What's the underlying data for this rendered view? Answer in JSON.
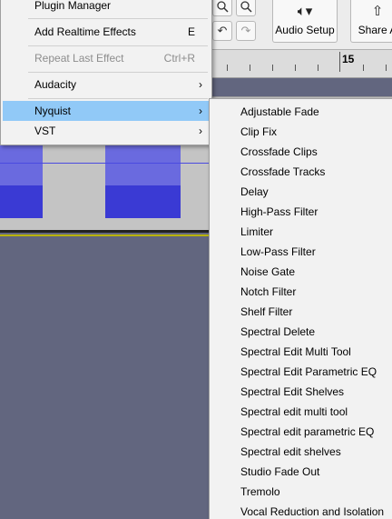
{
  "toolbar": {
    "zoom_in_icon": "zoom-in-icon",
    "zoom_out_icon": "zoom-out-icon",
    "undo_icon": "undo-icon",
    "redo_icon": "redo-icon",
    "audio_setup_label": "Audio Setup",
    "audio_setup_icon": "speaker-icon",
    "share_audio_label": "Share A",
    "share_audio_icon": "share-icon"
  },
  "ruler": {
    "label": "15"
  },
  "effect_menu": {
    "items": [
      {
        "label": "Plugin Manager",
        "shortcut": "",
        "submenu": false,
        "disabled": false
      },
      {
        "label": "Add Realtime Effects",
        "shortcut": "E",
        "submenu": false,
        "disabled": false
      },
      {
        "label": "Repeat Last Effect",
        "shortcut": "Ctrl+R",
        "submenu": false,
        "disabled": true
      },
      {
        "label": "Audacity",
        "shortcut": "",
        "submenu": true,
        "disabled": false
      },
      {
        "label": "Nyquist",
        "shortcut": "",
        "submenu": true,
        "disabled": false,
        "active": true
      },
      {
        "label": "VST",
        "shortcut": "",
        "submenu": true,
        "disabled": false
      }
    ],
    "arrow_glyph": "›"
  },
  "nyquist_submenu": {
    "items": [
      "Adjustable Fade",
      "Clip Fix",
      "Crossfade Clips",
      "Crossfade Tracks",
      "Delay",
      "High-Pass Filter",
      "Limiter",
      "Low-Pass Filter",
      "Noise Gate",
      "Notch Filter",
      "Shelf Filter",
      "Spectral Delete",
      "Spectral Edit Multi Tool",
      "Spectral Edit Parametric EQ",
      "Spectral Edit Shelves",
      "Spectral edit multi tool",
      "Spectral edit parametric EQ",
      "Spectral edit shelves",
      "Studio Fade Out",
      "Tremolo",
      "Vocal Reduction and Isolation"
    ]
  },
  "colors": {
    "menu_highlight": "#91c9f7",
    "clip_upper": "#6a6adf",
    "clip_lower": "#3a3ad4",
    "workspace": "#62667f"
  }
}
